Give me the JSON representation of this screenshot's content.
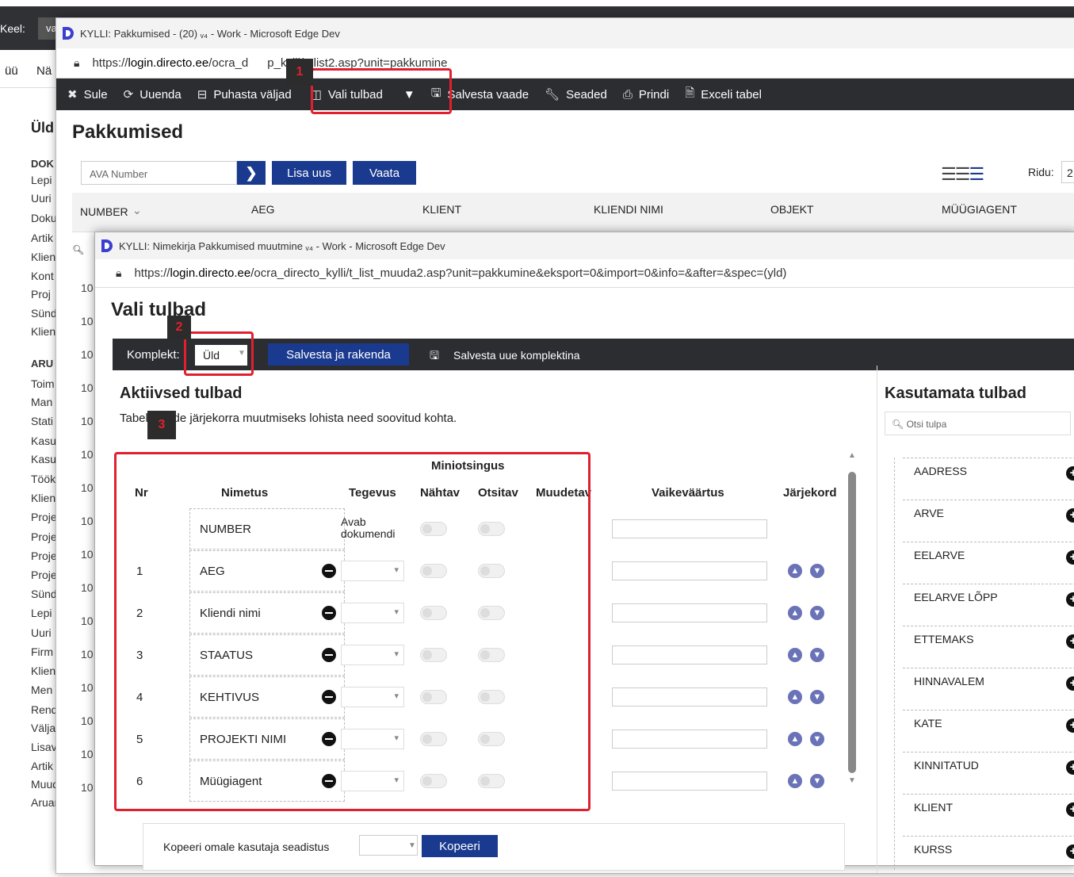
{
  "background": {
    "keel_label": "Keel:",
    "keel_value": "va",
    "menu_left": "üü",
    "menu_item": "Nä",
    "sidebar_title": "Üld",
    "sidebar_items": [
      {
        "label": "DOK",
        "head": true
      },
      {
        "label": "Lepi"
      },
      {
        "label": "Uuri"
      },
      {
        "label": "Doku"
      },
      {
        "label": "Artik"
      },
      {
        "label": "Klien"
      },
      {
        "label": "Kont"
      },
      {
        "label": "Proj"
      },
      {
        "label": "Sünd"
      },
      {
        "label": "Klien"
      },
      {
        "label": "ARU",
        "head": true
      },
      {
        "label": "Toim"
      },
      {
        "label": "Man"
      },
      {
        "label": "Stati"
      },
      {
        "label": "Kasu"
      },
      {
        "label": "Kasu"
      },
      {
        "label": "Töök"
      },
      {
        "label": "Klien"
      },
      {
        "label": "Proje"
      },
      {
        "label": "Proje"
      },
      {
        "label": "Proje"
      },
      {
        "label": "Proje"
      },
      {
        "label": "Sünd"
      },
      {
        "label": "Lepi"
      },
      {
        "label": "Uuri"
      },
      {
        "label": "Firm"
      },
      {
        "label": "Klien"
      },
      {
        "label": "Men"
      },
      {
        "label": "Rend"
      },
      {
        "label": "Välja"
      },
      {
        "label": "Lisav"
      },
      {
        "label": "Artik"
      },
      {
        "label": "Muudatuse"
      },
      {
        "label": "Aruande ko"
      }
    ]
  },
  "window1": {
    "title": "KYLLI: Pakkumised - (20) ᵥ₄ - Work - Microsoft Edge Dev",
    "url_prefix": "https://",
    "url_host": "login.directo.ee",
    "url_path": "/ocra_d",
    "url_tail": "p_kylli/t_list2.asp?unit=pakkumine",
    "toolbar": {
      "sule": "Sule",
      "uuenda": "Uuenda",
      "puhasta": "Puhasta väljad",
      "vali_tulbad": "Vali tulbad",
      "salvesta_vaade": "Salvesta vaade",
      "seaded": "Seaded",
      "prindi": "Prindi",
      "exceli": "Exceli tabel"
    },
    "page_title": "Pakkumised",
    "search_placeholder": "AVA Number",
    "lisa_uus": "Lisa uus",
    "vaata": "Vaata",
    "ridu_label": "Ridu:",
    "ridu_value": "2",
    "columns": [
      "NUMBER",
      "AEG",
      "KLIENT",
      "KLIENDI NIMI",
      "OBJEKT",
      "MÜÜGIAGENT"
    ],
    "row_prefixes": [
      "10",
      "10",
      "10",
      "10",
      "10",
      "10",
      "10",
      "10",
      "10",
      "10",
      "10",
      "10",
      "10",
      "10",
      "10",
      "10"
    ]
  },
  "window2": {
    "title": "KYLLI: Nimekirja Pakkumised muutmine ᵥ₄ - Work - Microsoft Edge Dev",
    "url_prefix": "https://",
    "url_host": "login.directo.ee",
    "url_path": "/ocra_directo_kylli/t_list_muuda2.asp?unit=pakkumine&eksport=0&import=0&info=&after=&spec=(yld)",
    "page_title": "Vali tulbad",
    "komplekt_label": "Komplekt:",
    "komplekt_value": "Üld",
    "salvesta_rakenda": "Salvesta ja rakenda",
    "salvesta_uue": "Salvesta uue komplektina",
    "active_title": "Aktiivsed tulbad",
    "active_hint": "Tabeli vaade järjekorra muutmiseks lohista need soovitud kohta.",
    "headers": {
      "miniotsingus": "Miniotsingus",
      "nr": "Nr",
      "nimetus": "Nimetus",
      "tegevus": "Tegevus",
      "nahtav": "Nähtav",
      "otsitav": "Otsitav",
      "muudetav": "Muudetav",
      "vaikevaartus": "Vaikeväärtus",
      "jarjekord": "Järjekord"
    },
    "rows": [
      {
        "nr": "",
        "name": "NUMBER",
        "tegevus": "Avab dokumendi"
      },
      {
        "nr": "1",
        "name": "AEG",
        "tegevus": ""
      },
      {
        "nr": "2",
        "name": "Kliendi nimi",
        "tegevus": ""
      },
      {
        "nr": "3",
        "name": "STAATUS",
        "tegevus": ""
      },
      {
        "nr": "4",
        "name": "KEHTIVUS",
        "tegevus": ""
      },
      {
        "nr": "5",
        "name": "PROJEKTI NIMI",
        "tegevus": ""
      },
      {
        "nr": "6",
        "name": "Müügiagent",
        "tegevus": ""
      }
    ],
    "kopeeri_label": "Kopeeri omale kasutaja seadistus",
    "kopeeri_btn": "Kopeeri",
    "unused_title": "Kasutamata tulbad",
    "unused_search_placeholder": "Otsi tulpa",
    "unused": [
      "AADRESS",
      "ARVE",
      "EELARVE",
      "EELARVE LÕPP",
      "ETTEMAKS",
      "HINNAVALEM",
      "KATE",
      "KINNITATUD",
      "KLIENT",
      "KURSS"
    ]
  },
  "annotations": [
    "1",
    "2",
    "3"
  ],
  "colors": {
    "accent": "#1a3a8f",
    "highlight": "#e0202f",
    "toolbar": "#2b2d31"
  }
}
